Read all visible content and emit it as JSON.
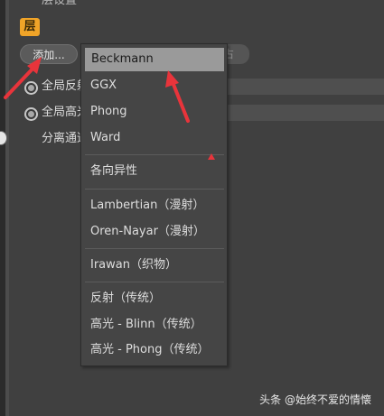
{
  "header": {
    "section_title": "层设置",
    "layer_badge": "层",
    "add_button": "添加...",
    "partial_field_text": "占"
  },
  "rows": [
    {
      "label": "全局反射"
    },
    {
      "label": "全局高光"
    },
    {
      "label": "分离通道"
    }
  ],
  "menu": {
    "items": [
      {
        "label": "Beckmann",
        "selected": true
      },
      {
        "label": "GGX"
      },
      {
        "label": "Phong"
      },
      {
        "label": "Ward"
      },
      {
        "label": "各向异性"
      },
      {
        "label": "Lambertian（漫射）"
      },
      {
        "label": "Oren-Nayar（漫射）"
      },
      {
        "label": "Irawan（织物）"
      },
      {
        "label": "反射（传统）"
      },
      {
        "label": "高光 - Blinn（传统）"
      },
      {
        "label": "高光 - Phong（传统）"
      }
    ]
  },
  "watermark": "头条 @始终不爱的情懐",
  "colors": {
    "background": "#404040",
    "menu_background": "#454545",
    "selected_item": "#9a9a9a",
    "badge": "#f0a428",
    "annotation_arrow": "#e8343b"
  }
}
